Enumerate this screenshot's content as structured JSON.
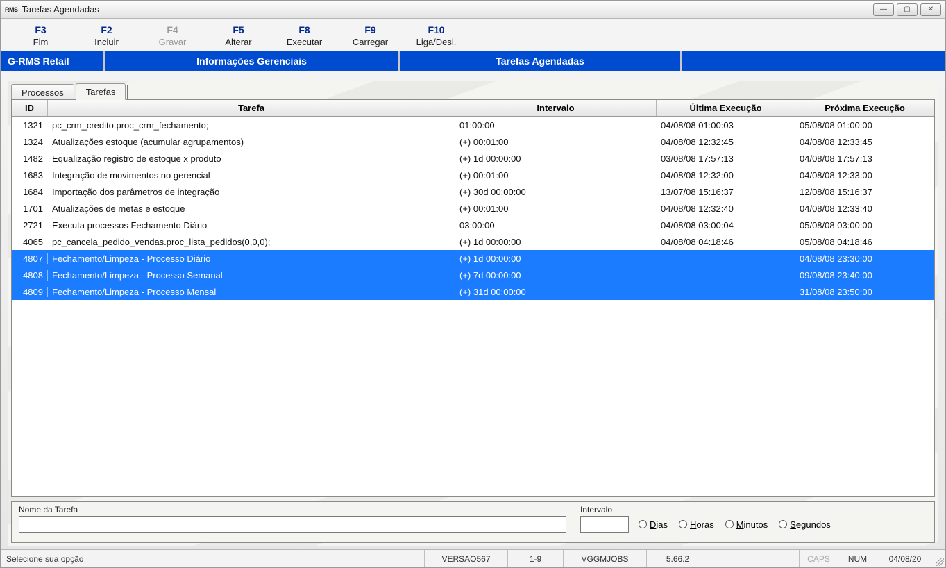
{
  "window": {
    "app_icon": "RMS",
    "title": "Tarefas Agendadas"
  },
  "toolbar": [
    {
      "key": "F3",
      "label": "Fim",
      "enabled": true
    },
    {
      "key": "F2",
      "label": "Incluir",
      "enabled": true
    },
    {
      "key": "F4",
      "label": "Gravar",
      "enabled": false
    },
    {
      "key": "F5",
      "label": "Alterar",
      "enabled": true
    },
    {
      "key": "F8",
      "label": "Executar",
      "enabled": true
    },
    {
      "key": "F9",
      "label": "Carregar",
      "enabled": true
    },
    {
      "key": "F10",
      "label": "Liga/Desl.",
      "enabled": true
    }
  ],
  "bluebar": {
    "brand": "G-RMS Retail",
    "middle": "Informações Gerenciais",
    "right": "Tarefas Agendadas"
  },
  "tabs": {
    "inactive": "Processos",
    "active": "Tarefas"
  },
  "grid": {
    "headers": {
      "id": "ID",
      "task": "Tarefa",
      "interval": "Intervalo",
      "last": "Última Execução",
      "next": "Próxima Execução"
    },
    "rows": [
      {
        "id": "1321",
        "task": "pc_crm_credito.proc_crm_fechamento;",
        "interval": "01:00:00",
        "last": "04/08/08 01:00:03",
        "next": "05/08/08 01:00:00",
        "sel": false
      },
      {
        "id": "1324",
        "task": "Atualizações estoque (acumular agrupamentos)",
        "interval": "(+) 00:01:00",
        "last": "04/08/08 12:32:45",
        "next": "04/08/08 12:33:45",
        "sel": false
      },
      {
        "id": "1482",
        "task": "Equalização registro de estoque x produto",
        "interval": "(+) 1d 00:00:00",
        "last": "03/08/08 17:57:13",
        "next": "04/08/08 17:57:13",
        "sel": false
      },
      {
        "id": "1683",
        "task": "Integração de movimentos no gerencial",
        "interval": "(+) 00:01:00",
        "last": "04/08/08 12:32:00",
        "next": "04/08/08 12:33:00",
        "sel": false
      },
      {
        "id": "1684",
        "task": "Importação dos parâmetros de integração",
        "interval": "(+) 30d 00:00:00",
        "last": "13/07/08 15:16:37",
        "next": "12/08/08 15:16:37",
        "sel": false
      },
      {
        "id": "1701",
        "task": "Atualizações de metas e estoque",
        "interval": "(+) 00:01:00",
        "last": "04/08/08 12:32:40",
        "next": "04/08/08 12:33:40",
        "sel": false
      },
      {
        "id": "2721",
        "task": "Executa processos Fechamento Diário",
        "interval": "03:00:00",
        "last": "04/08/08 03:00:04",
        "next": "05/08/08 03:00:00",
        "sel": false
      },
      {
        "id": "4065",
        "task": "pc_cancela_pedido_vendas.proc_lista_pedidos(0,0,0);",
        "interval": "(+) 1d 00:00:00",
        "last": "04/08/08 04:18:46",
        "next": "05/08/08 04:18:46",
        "sel": false
      },
      {
        "id": "4807",
        "task": "Fechamento/Limpeza - Processo Diário",
        "interval": "(+) 1d 00:00:00",
        "last": "",
        "next": "04/08/08 23:30:00",
        "sel": true
      },
      {
        "id": "4808",
        "task": "Fechamento/Limpeza - Processo Semanal",
        "interval": "(+) 7d 00:00:00",
        "last": "",
        "next": "09/08/08 23:40:00",
        "sel": true
      },
      {
        "id": "4809",
        "task": "Fechamento/Limpeza - Processo Mensal",
        "interval": "(+) 31d 00:00:00",
        "last": "",
        "next": "31/08/08 23:50:00",
        "sel": true
      }
    ]
  },
  "form": {
    "task_name_label": "Nome da Tarefa",
    "task_name_value": "",
    "interval_label": "Intervalo",
    "interval_value": "",
    "radios": {
      "dias": "Dias",
      "horas": "Horas",
      "minutos": "Minutos",
      "segundos": "Segundos"
    }
  },
  "status": {
    "message": "Selecione sua opção",
    "version": "VERSAO567",
    "range": "1-9",
    "job": "VGGMJOBS",
    "build": "5.66.2",
    "caps": "CAPS",
    "num": "NUM",
    "date": "04/08/20"
  }
}
